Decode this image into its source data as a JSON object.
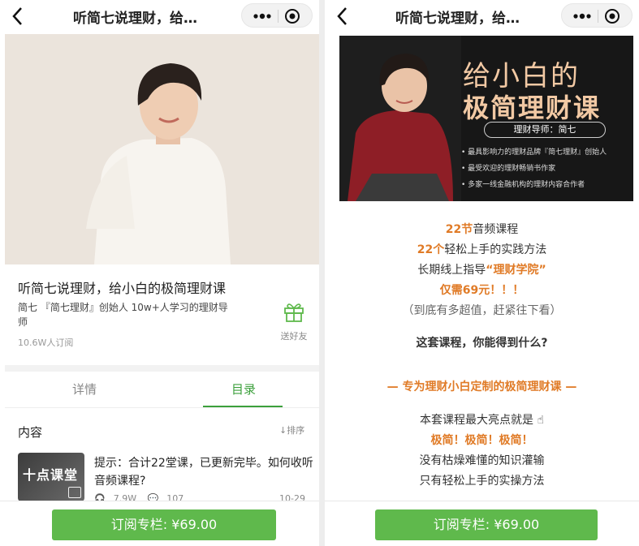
{
  "left": {
    "nav": {
      "title": "听简七说理财，给…"
    },
    "course": {
      "title": "听简七说理财，给小白的极简理财课",
      "description": "简七 『简七理财』创始人 10w+人学习的理财导师",
      "subscribers": "10.6W人订阅",
      "gift_label": "送好友"
    },
    "tabs": [
      {
        "label": "详情"
      },
      {
        "label": "目录"
      }
    ],
    "content": {
      "title": "内容",
      "sort": "↓排序"
    },
    "list": {
      "thumb_text": "十点课堂",
      "text": "提示：合计22堂课，已更新完毕。如何收听音频课程?",
      "plays": "7.9W",
      "comments": "107",
      "date": "10-29"
    },
    "subscribe_button": "订阅专栏: ¥69.00"
  },
  "right": {
    "nav": {
      "title": "听简七说理财，给…"
    },
    "banner": {
      "line1": "给小白的",
      "line2": "极简理财课",
      "mentor": "理财导师：简七",
      "bullets": [
        "• 最具影响力的理财品牌『简七理财』创始人",
        "• 最受欢迎的理财畅销书作家",
        "• 多家一线金融机构的理财内容合作者"
      ]
    },
    "promo": {
      "l1_hi": "22节",
      "l1_rest": "音频课程",
      "l2_hi": "22个",
      "l2_rest": "轻松上手的实践方法",
      "l3_pre": "长期线上指导",
      "l3_hi": "“理财学院”",
      "l4": "仅需69元！！！",
      "l5": "（到底有多超值，赶紧往下看）",
      "question": "这套课程，你能得到什么?",
      "section_heading": "— 专为理财小白定制的极简理财课 —",
      "highlight_intro": "本套课程最大亮点就是",
      "highlight": "极简！极简！极简！",
      "no_theory": "没有枯燥难懂的知识灌输",
      "only_practice": "只有轻松上手的实操方法"
    },
    "subscribe_button": "订阅专栏: ¥69.00"
  },
  "colors": {
    "accent_green": "#5fb94c",
    "tab_green": "#3ca03c",
    "promo_orange": "#e07b27",
    "banner_gold": "#f2c9a4"
  },
  "icons": [
    "back-arrow-icon",
    "more-dots-icon",
    "close-target-icon",
    "gift-icon",
    "headphone-icon",
    "comment-icon",
    "sort-arrow-icon",
    "hand-icon"
  ]
}
